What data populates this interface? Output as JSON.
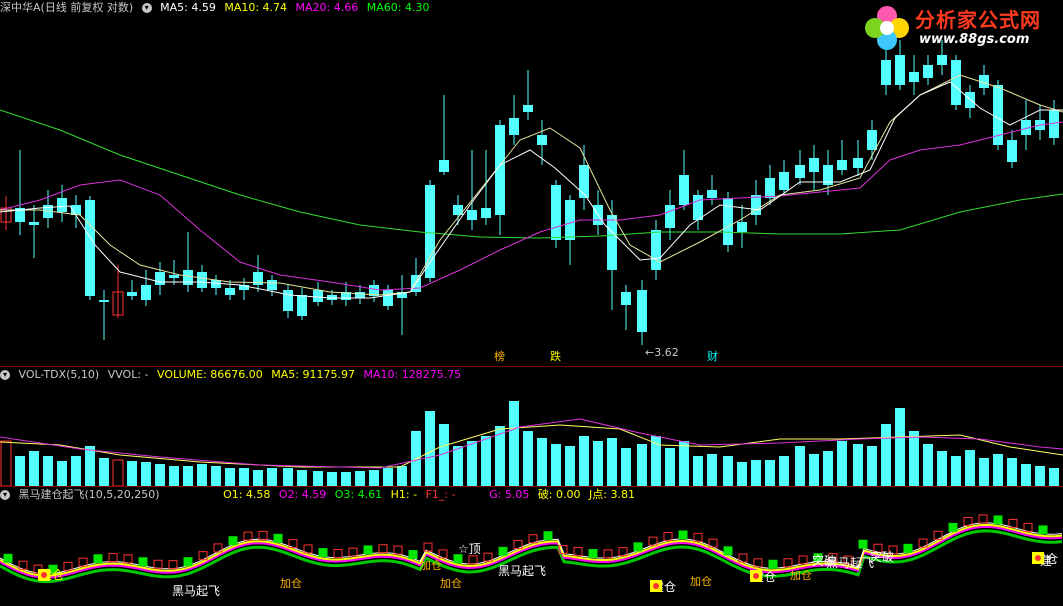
{
  "main": {
    "stock": "深中华A",
    "period": "(日线 前复权 对数)",
    "ma": [
      {
        "label": "MA5: 4.59",
        "color": "#ffffff"
      },
      {
        "label": "MA10: 4.74",
        "color": "#ffff00"
      },
      {
        "label": "MA20: 4.66",
        "color": "#ff00ff"
      },
      {
        "label": "MA60: 4.30",
        "color": "#00ff00"
      }
    ],
    "low_label": "3.62",
    "events": [
      {
        "text": "榜",
        "color": "#ffb400"
      },
      {
        "text": "跌",
        "color": "#ffff00"
      },
      {
        "text": "财",
        "color": "#00ffff"
      }
    ]
  },
  "volume": {
    "name": "VOL-TDX(5,10)",
    "vvol": "VVOL: -",
    "volume": "VOLUME: 86676.00",
    "ma5": "MA5: 91175.97",
    "ma10": "MA10: 128275.75"
  },
  "indicator": {
    "name": "黑马建仓起飞(10,5,20,250)",
    "o1": "O1: 4.58",
    "o2": "O2: 4.59",
    "o3": "O3: 4.61",
    "h1": "H1: -",
    "f1": "F1_: -",
    "g": "G: 5.05",
    "po": "破: 0.00",
    "j": "J点: 3.81",
    "labels": [
      "建仓",
      "黑马起飞",
      "☆顶",
      "黑马起飞",
      "建仓",
      "建仓",
      "建仓",
      "突破",
      "黑马起飞",
      "突破",
      "建"
    ],
    "extra": [
      "加仓",
      "加仓",
      "加仓",
      "加仓",
      "加仓"
    ]
  },
  "logo": {
    "title": "分析家公式网",
    "url": "www.88gs.com"
  }
}
